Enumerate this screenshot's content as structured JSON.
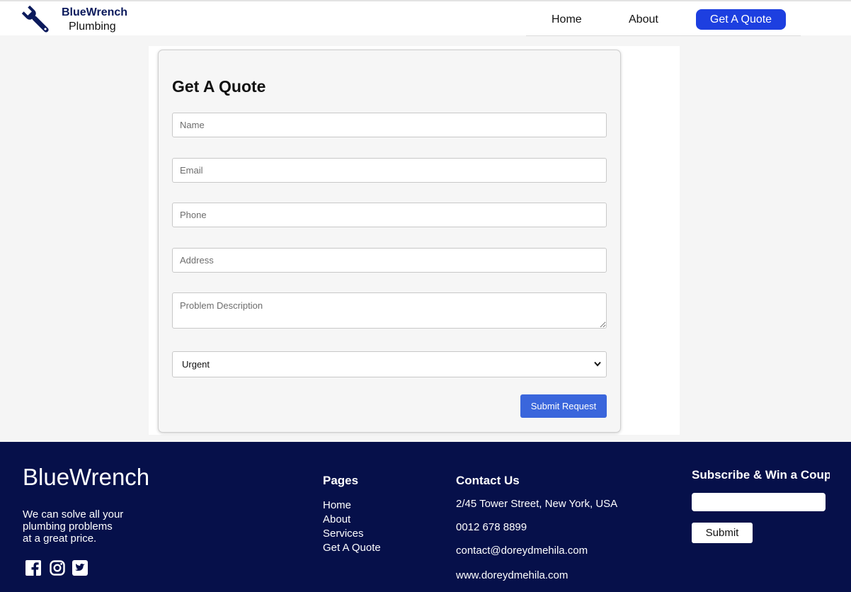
{
  "brand": {
    "name": "BlueWrench",
    "subtitle": "Plumbing"
  },
  "nav": {
    "home": "Home",
    "about": "About",
    "quote": "Get A Quote"
  },
  "form": {
    "title": "Get A Quote",
    "fields": {
      "name": {
        "placeholder": "Name",
        "value": ""
      },
      "email": {
        "placeholder": "Email",
        "value": ""
      },
      "phone": {
        "placeholder": "Phone",
        "value": ""
      },
      "address": {
        "placeholder": "Address",
        "value": ""
      },
      "description": {
        "placeholder": "Problem Description",
        "value": ""
      }
    },
    "urgency": {
      "selected": "Urgent"
    },
    "submit_label": "Submit Request"
  },
  "footer": {
    "brand": "BlueWrench",
    "tagline": [
      "We can solve all your",
      "plumbing problems",
      "at a great price."
    ],
    "social_icons": [
      "facebook-icon",
      "instagram-icon",
      "twitter-icon"
    ],
    "pages": {
      "heading": "Pages",
      "links": [
        "Home",
        "About",
        "Services",
        "Get A Quote"
      ]
    },
    "contact": {
      "heading": "Contact Us",
      "address": "2/45 Tower Street, New York, USA",
      "phone": "0012 678 8899",
      "email": "contact@doreydmehila.com",
      "website": "www.doreydmehila.com"
    },
    "subscribe": {
      "heading": "Subscribe & Win a Coupon",
      "input_value": "",
      "button_label": "Submit"
    }
  },
  "colors": {
    "brand_navy": "#0b1a5c",
    "nav_button": "#1d3fe0",
    "submit_button": "#3a66dc",
    "footer_bg": "#06104a"
  }
}
